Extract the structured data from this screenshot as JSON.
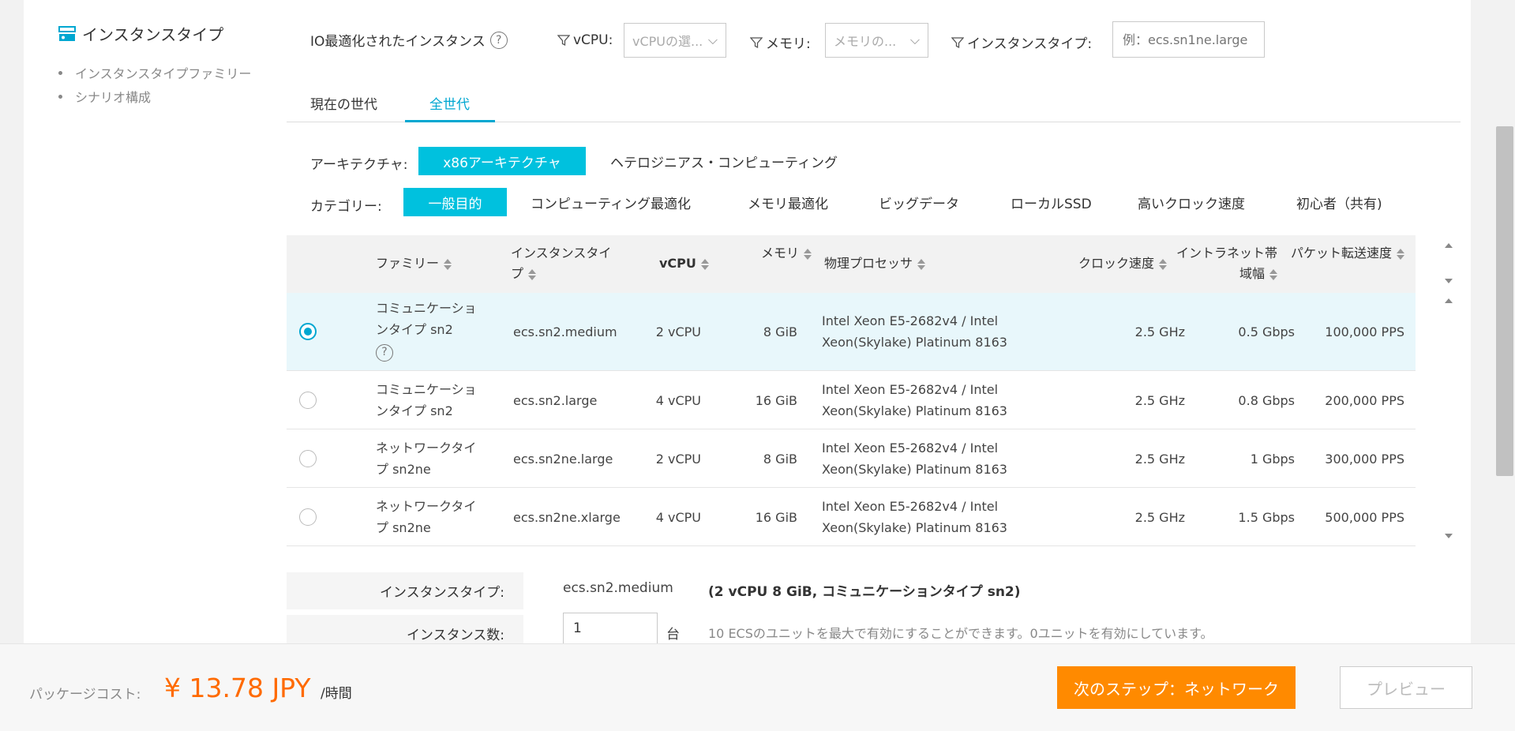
{
  "section": {
    "title": "インスタンスタイプ",
    "nav": [
      "インスタンスタイプファミリー",
      "シナリオ構成"
    ]
  },
  "filters": {
    "io_label": "IO最適化されたインスタンス",
    "help_glyph": "?",
    "vcpu_label": "vCPU:",
    "vcpu_placeholder": "vCPUの選...",
    "memory_label": "メモリ:",
    "memory_placeholder": "メモリの...",
    "type_label": "インスタンスタイプ:",
    "type_placeholder": "例：ecs.sn1ne.large"
  },
  "tabs": {
    "current": "現在の世代",
    "all": "全世代"
  },
  "architecture": {
    "label": "アーキテクチャ:",
    "options": [
      "x86アーキテクチャ",
      "ヘテロジニアス・コンピューティング"
    ],
    "selected": 0
  },
  "category": {
    "label": "カテゴリー:",
    "options": [
      "一般目的",
      "コンピューティング最適化",
      "メモリ最適化",
      "ビッグデータ",
      "ローカルSSD",
      "高いクロック速度",
      "初心者（共有)"
    ],
    "selected": 0
  },
  "table": {
    "headers": {
      "family": "ファミリー",
      "type": "インスタンスタイプ",
      "vcpu": "vCPU",
      "memory": "メモリ",
      "processor": "物理プロセッサ",
      "clock": "クロック速度",
      "intranet": "イントラネット帯域幅",
      "pps": "パケット転送速度"
    },
    "rows": [
      {
        "family": "コミュニケーションタイプ sn2",
        "type": "ecs.sn2.medium",
        "vcpu": "2 vCPU",
        "memory": "8 GiB",
        "processor": "Intel Xeon E5-2682v4 / Intel Xeon(Skylake) Platinum 8163",
        "clock": "2.5 GHz",
        "intranet": "0.5 Gbps",
        "pps": "100,000 PPS",
        "selected": true
      },
      {
        "family": "コミュニケーションタイプ sn2",
        "type": "ecs.sn2.large",
        "vcpu": "4 vCPU",
        "memory": "16 GiB",
        "processor": "Intel Xeon E5-2682v4 / Intel Xeon(Skylake) Platinum 8163",
        "clock": "2.5 GHz",
        "intranet": "0.8 Gbps",
        "pps": "200,000 PPS",
        "selected": false
      },
      {
        "family": "ネットワークタイプ sn2ne",
        "type": "ecs.sn2ne.large",
        "vcpu": "2 vCPU",
        "memory": "8 GiB",
        "processor": "Intel Xeon E5-2682v4 / Intel Xeon(Skylake) Platinum 8163",
        "clock": "2.5 GHz",
        "intranet": "1 Gbps",
        "pps": "300,000 PPS",
        "selected": false
      },
      {
        "family": "ネットワークタイプ sn2ne",
        "type": "ecs.sn2ne.xlarge",
        "vcpu": "4 vCPU",
        "memory": "16 GiB",
        "processor": "Intel Xeon E5-2682v4 / Intel Xeon(Skylake) Platinum 8163",
        "clock": "2.5 GHz",
        "intranet": "1.5 Gbps",
        "pps": "500,000 PPS",
        "selected": false
      }
    ]
  },
  "summary": {
    "type_label": "インスタンスタイプ:",
    "type_value": "ecs.sn2.medium",
    "type_detail": "(2 vCPU 8 GiB, コミュニケーションタイプ sn2)",
    "count_label": "インスタンス数:",
    "count_value": "1",
    "count_unit": "台",
    "count_note": "10 ECSのユニットを最大で有効にすることができます。0ユニットを有効にしています。"
  },
  "footer": {
    "cost_label": "パッケージコスト:",
    "cost_value": "¥ 13.78 JPY",
    "cost_unit": "/時間",
    "next": "次のステップ：ネットワーク",
    "preview": "プレビュー"
  },
  "colors": {
    "accent": "#00c1de",
    "orange": "#ff8a00",
    "radio": "#00a7d1"
  }
}
